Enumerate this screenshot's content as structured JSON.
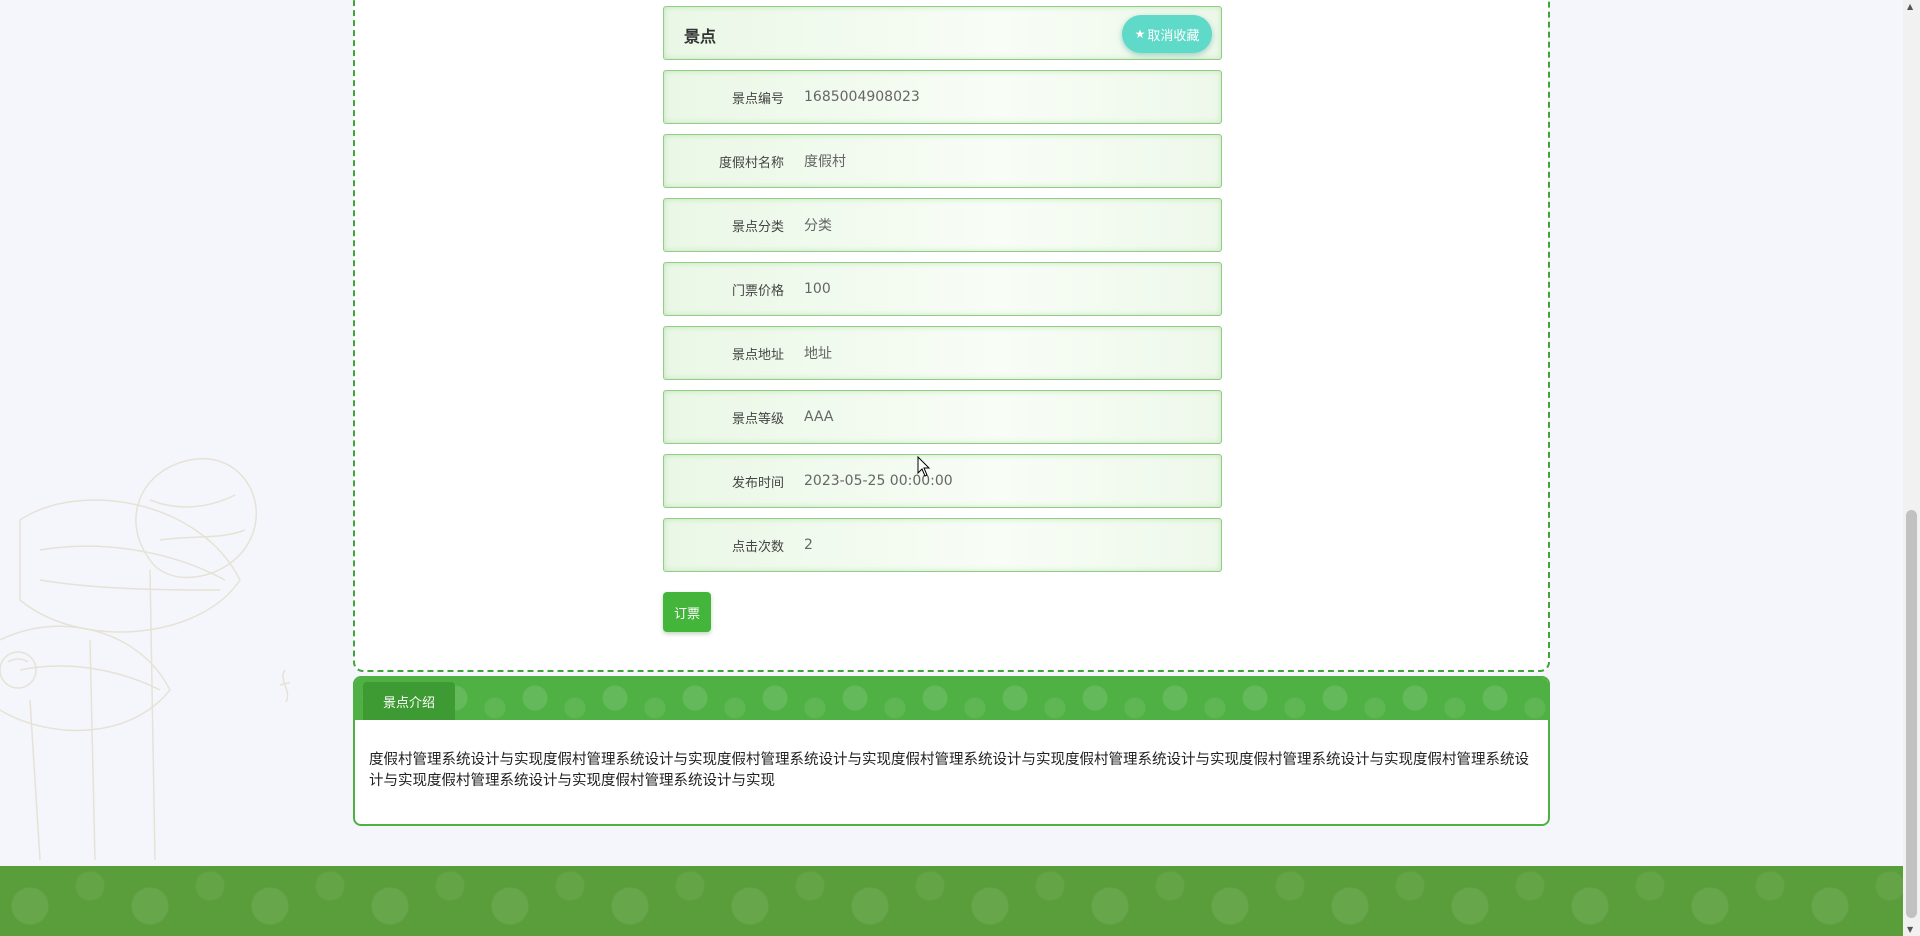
{
  "detail": {
    "title": "景点",
    "favorite_button": "取消收藏",
    "rows": [
      {
        "label": "景点编号",
        "value": "1685004908023"
      },
      {
        "label": "度假村名称",
        "value": "度假村"
      },
      {
        "label": "景点分类",
        "value": "分类"
      },
      {
        "label": "门票价格",
        "value": "100"
      },
      {
        "label": "景点地址",
        "value": "地址"
      },
      {
        "label": "景点等级",
        "value": "AAA"
      },
      {
        "label": "发布时间",
        "value": "2023-05-25 00:00:00"
      },
      {
        "label": "点击次数",
        "value": "2"
      }
    ],
    "book_button": "订票"
  },
  "intro": {
    "tab_label": "景点介绍",
    "content": "度假村管理系统设计与实现度假村管理系统设计与实现度假村管理系统设计与实现度假村管理系统设计与实现度假村管理系统设计与实现度假村管理系统设计与实现度假村管理系统设计与实现度假村管理系统设计与实现度假村管理系统设计与实现"
  },
  "colors": {
    "accent_green": "#43b53a",
    "favorite_teal": "#5fd9c8",
    "footer_green": "#5a9e3c"
  },
  "icons": {
    "favorite": "star-icon"
  }
}
